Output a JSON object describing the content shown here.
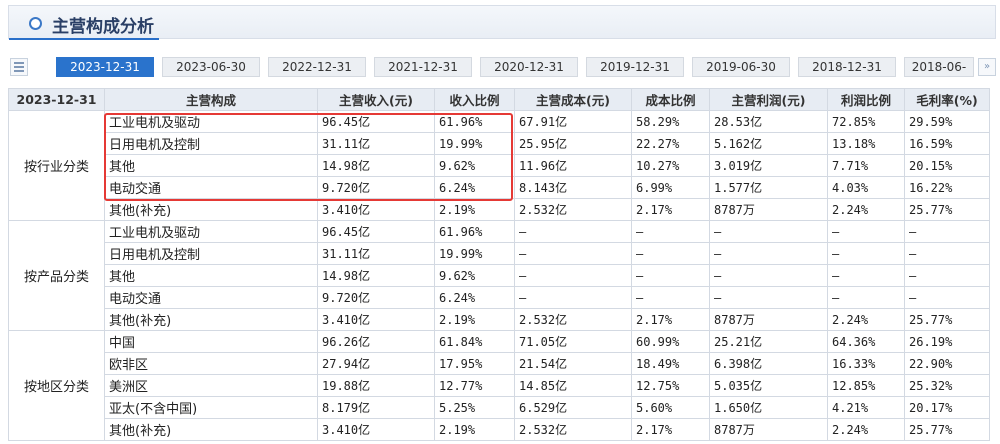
{
  "section": {
    "title": "主营构成分析"
  },
  "tabs": [
    "2023-12-31",
    "2023-06-30",
    "2022-12-31",
    "2021-12-31",
    "2020-12-31",
    "2019-12-31",
    "2019-06-30",
    "2018-12-31",
    "2018-06-"
  ],
  "active_tab": 0,
  "table": {
    "headers": [
      "2023-12-31",
      "主营构成",
      "主营收入(元)",
      "收入比例",
      "主营成本(元)",
      "成本比例",
      "主营利润(元)",
      "利润比例",
      "毛利率(%)"
    ],
    "groups": [
      {
        "category": "按行业分类",
        "rows": [
          [
            "工业电机及驱动",
            "96.45亿",
            "61.96%",
            "67.91亿",
            "58.29%",
            "28.53亿",
            "72.85%",
            "29.59%"
          ],
          [
            "日用电机及控制",
            "31.11亿",
            "19.99%",
            "25.95亿",
            "22.27%",
            "5.162亿",
            "13.18%",
            "16.59%"
          ],
          [
            "其他",
            "14.98亿",
            "9.62%",
            "11.96亿",
            "10.27%",
            "3.019亿",
            "7.71%",
            "20.15%"
          ],
          [
            "电动交通",
            "9.720亿",
            "6.24%",
            "8.143亿",
            "6.99%",
            "1.577亿",
            "4.03%",
            "16.22%"
          ],
          [
            "其他(补充)",
            "3.410亿",
            "2.19%",
            "2.532亿",
            "2.17%",
            "8787万",
            "2.24%",
            "25.77%"
          ]
        ]
      },
      {
        "category": "按产品分类",
        "rows": [
          [
            "工业电机及驱动",
            "96.45亿",
            "61.96%",
            "—",
            "—",
            "—",
            "—",
            "—"
          ],
          [
            "日用电机及控制",
            "31.11亿",
            "19.99%",
            "—",
            "—",
            "—",
            "—",
            "—"
          ],
          [
            "其他",
            "14.98亿",
            "9.62%",
            "—",
            "—",
            "—",
            "—",
            "—"
          ],
          [
            "电动交通",
            "9.720亿",
            "6.24%",
            "—",
            "—",
            "—",
            "—",
            "—"
          ],
          [
            "其他(补充)",
            "3.410亿",
            "2.19%",
            "2.532亿",
            "2.17%",
            "8787万",
            "2.24%",
            "25.77%"
          ]
        ]
      },
      {
        "category": "按地区分类",
        "rows": [
          [
            "中国",
            "96.26亿",
            "61.84%",
            "71.05亿",
            "60.99%",
            "25.21亿",
            "64.36%",
            "26.19%"
          ],
          [
            "欧非区",
            "27.94亿",
            "17.95%",
            "21.54亿",
            "18.49%",
            "6.398亿",
            "16.33%",
            "22.90%"
          ],
          [
            "美洲区",
            "19.88亿",
            "12.77%",
            "14.85亿",
            "12.75%",
            "5.035亿",
            "12.85%",
            "25.32%"
          ],
          [
            "亚太(不含中国)",
            "8.179亿",
            "5.25%",
            "6.529亿",
            "5.60%",
            "1.650亿",
            "4.21%",
            "20.17%"
          ],
          [
            "其他(补充)",
            "3.410亿",
            "2.19%",
            "2.532亿",
            "2.17%",
            "8787万",
            "2.24%",
            "25.77%"
          ]
        ]
      }
    ]
  },
  "colors": {
    "accent": "#2a73cc",
    "highlight": "#e53935",
    "header_bg": "#e7ecf3"
  }
}
